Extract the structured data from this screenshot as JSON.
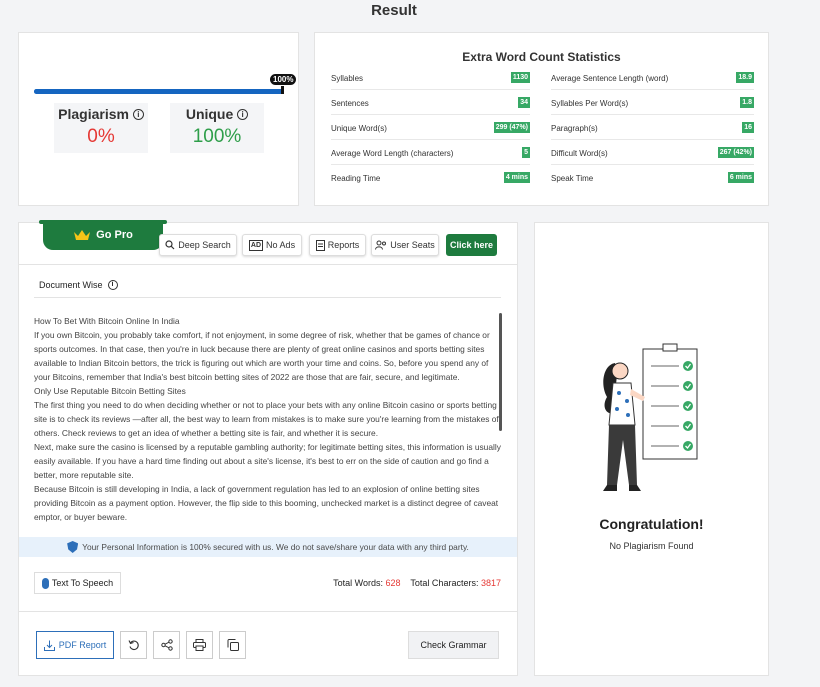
{
  "page": {
    "title": "Result"
  },
  "result": {
    "progress_label": "100%",
    "progress_value": 1.0,
    "plagiarism_label": "Plagiarism",
    "plagiarism_value": "0%",
    "unique_label": "Unique",
    "unique_value": "100%"
  },
  "stats": {
    "title": "Extra Word Count Statistics",
    "left": [
      {
        "label": "Syllables",
        "value": "1130"
      },
      {
        "label": "Sentences",
        "value": "34"
      },
      {
        "label": "Unique Word(s)",
        "value": "299 (47%)"
      },
      {
        "label": "Average Word Length (characters)",
        "value": "5"
      },
      {
        "label": "Reading Time",
        "value": "4 mins"
      }
    ],
    "right": [
      {
        "label": "Average Sentence Length (word)",
        "value": "18.9"
      },
      {
        "label": "Syllables Per Word(s)",
        "value": "1.8"
      },
      {
        "label": "Paragraph(s)",
        "value": "16"
      },
      {
        "label": "Difficult Word(s)",
        "value": "267 (42%)"
      },
      {
        "label": "Speak Time",
        "value": "6 mins"
      }
    ],
    "badge_color": "#37a865"
  },
  "toolbar": {
    "gopro": "Go Pro",
    "deep_search": "Deep Search",
    "no_ads": "No Ads",
    "reports": "Reports",
    "user_seats": "User Seats",
    "click_here": "Click here"
  },
  "document": {
    "heading": "Document Wise",
    "paragraphs": [
      "How To Bet With Bitcoin Online In India",
      "If you own Bitcoin, you probably take comfort, if not enjoyment, in some degree of risk, whether that be games of chance or sports outcomes. In that case, then you're in luck because there are plenty of great online casinos and sports betting sites available to Indian Bitcoin bettors, the trick is figuring out which are worth your time and coins. So, before you spend any of your Bitcoins, remember that India's best bitcoin betting sites of 2022 are those that are fair, secure, and legitimate.",
      "Only Use Reputable Bitcoin Betting Sites",
      "The first thing you need to do when deciding whether or not to place your bets with any online Bitcoin casino or sports betting site is to check its reviews —after all, the best way to learn from mistakes is to make sure you're learning from the mistakes of others. Check reviews to get an idea of whether a betting site is fair, and whether it is secure.",
      "Next, make sure the casino is licensed by a reputable gambling authority; for legitimate betting sites, this information is usually easily available. If you have a hard time finding out about a site's license, it's best to err on the side of caution and go find a better, more reputable site.",
      "Because Bitcoin is still developing in India, a lack of government regulation has led to an explosion of online betting sites providing Bitcoin as a payment option. However, the flip side to this booming, unchecked market is a distinct degree of caveat emptor, or buyer beware."
    ],
    "secure_notice": "Your Personal Information is 100% secured with us. We do not save/share your data with any third party."
  },
  "footer": {
    "tts": "Text To Speech",
    "total_words_label": "Total Words:",
    "total_words": "628",
    "total_chars_label": "Total Characters:",
    "total_chars": "3817",
    "pdf_report": "PDF Report",
    "check_grammar": "Check Grammar"
  },
  "congrats": {
    "title": "Congratulation!",
    "subtitle": "No Plagiarism Found"
  }
}
